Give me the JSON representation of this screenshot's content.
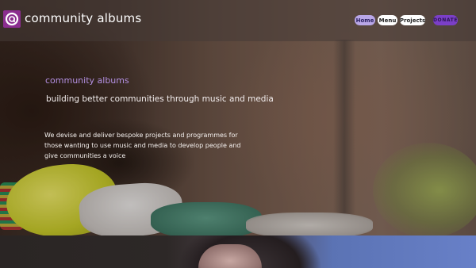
{
  "header": {
    "brand": "community albums",
    "nav": {
      "home": "Home",
      "menu": "Menu",
      "projects": "Projects",
      "donate": "DONATE"
    }
  },
  "hero": {
    "title": "community albums",
    "tagline": "building better communities through music and media",
    "description": "We devise and deliver bespoke projects and programmes for those wanting to use music and media to develop people and give communities a voice"
  },
  "colors": {
    "logo_bg": "#8b2d8f",
    "accent_lavender": "#b9a7e8",
    "donate": "#7b3fc7",
    "hero_title": "#b28fe0"
  },
  "icons": {
    "logo": "community-albums-logo-icon"
  }
}
